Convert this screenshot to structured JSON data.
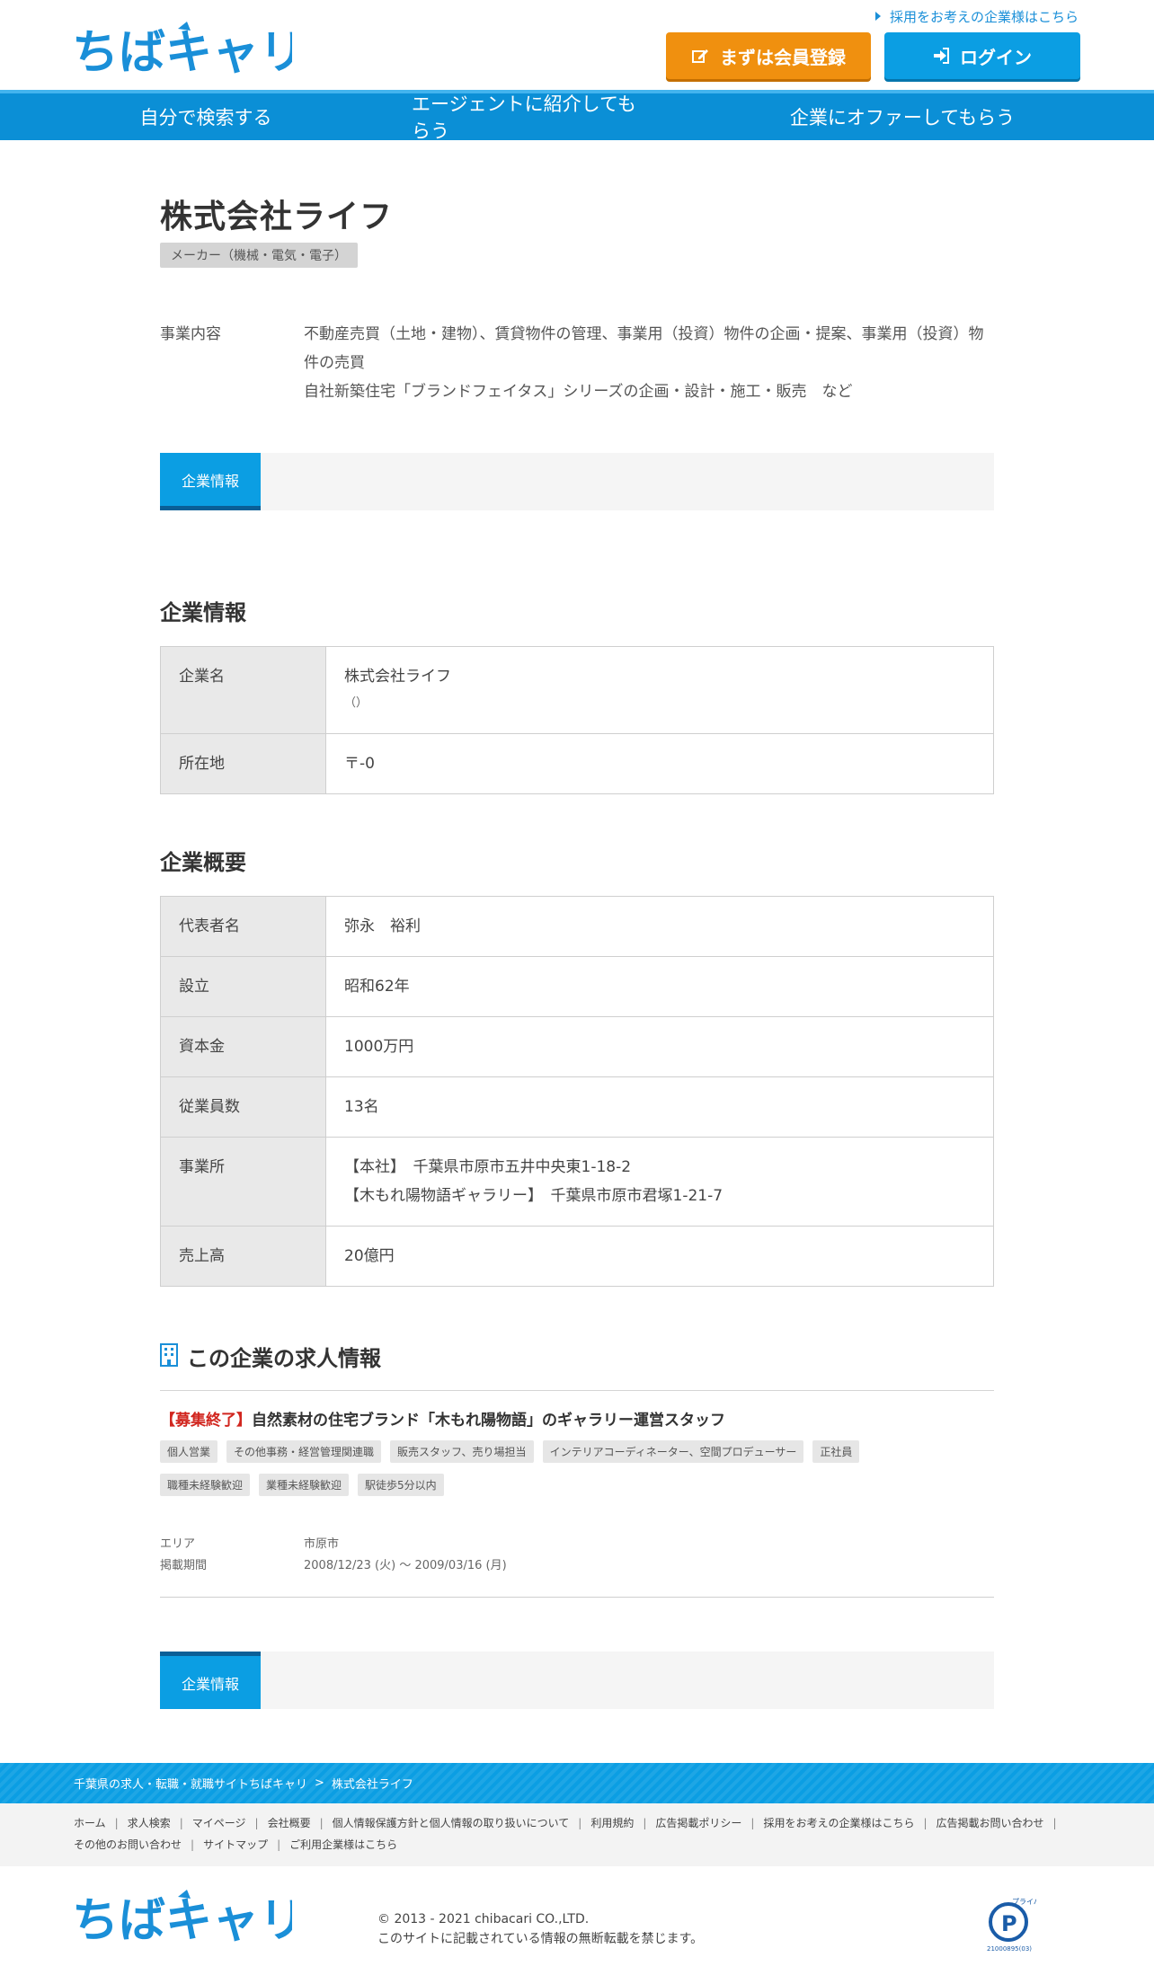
{
  "header": {
    "logo_text": "ちばキャリ",
    "corporate_link": "採用をお考えの企業様はこちら",
    "register_label": "まずは会員登録",
    "login_label": "ログイン"
  },
  "nav": {
    "items": [
      "自分で検索する",
      "エージェントに紹介してもらう",
      "企業にオファーしてもらう"
    ]
  },
  "company": {
    "name": "株式会社ライフ",
    "industry": "メーカー（機械・電気・電子）",
    "business_label": "事業内容",
    "business_line1": "不動産売買（土地・建物）、賃貸物件の管理、事業用（投資）物件の企画・提案、事業用（投資）物件の売買",
    "business_line2": "自社新築住宅「ブランドフェイタス」シリーズの企画・設計・施工・販売　など"
  },
  "tab_label": "企業情報",
  "info_section": {
    "heading": "企業情報",
    "rows": [
      {
        "label": "企業名",
        "value": "株式会社ライフ",
        "sub": "（）"
      },
      {
        "label": "所在地",
        "value": "〒-0"
      }
    ]
  },
  "overview_section": {
    "heading": "企業概要",
    "rows": [
      {
        "label": "代表者名",
        "value": "弥永　裕利"
      },
      {
        "label": "設立",
        "value": "昭和62年"
      },
      {
        "label": "資本金",
        "value": "1000万円"
      },
      {
        "label": "従業員数",
        "value": "13名"
      },
      {
        "label": "事業所",
        "value": "【本社】　千葉県市原市五井中央東1-18-2",
        "value2": "【木もれ陽物語ギャラリー】　千葉県市原市君塚1-21-7"
      },
      {
        "label": "売上高",
        "value": "20億円"
      }
    ]
  },
  "jobs": {
    "heading": "この企業の求人情報",
    "job": {
      "status": "【募集終了】",
      "title": "自然素材の住宅ブランド「木もれ陽物語」のギャラリー運営スタッフ",
      "tags": [
        "個人営業",
        "その他事務・経営管理関連職",
        "販売スタッフ、売り場担当",
        "インテリアコーディネーター、空間プロデューサー",
        "正社員",
        "職種未経験歓迎",
        "業種未経験歓迎",
        "駅徒歩5分以内"
      ],
      "area_label": "エリア",
      "area": "市原市",
      "period_label": "掲載期間",
      "period": "2008/12/23 (火) ～ 2009/03/16 (月)"
    }
  },
  "footer": {
    "breadcrumb": [
      "千葉県の求人・転職・就職サイトちばキャリ",
      "株式会社ライフ"
    ],
    "breadcrumb_sep": ">",
    "links": [
      "ホーム",
      "求人検索",
      "マイページ",
      "会社概要",
      "個人情報保護方針と個人情報の取り扱いについて",
      "利用規約",
      "広告掲載ポリシー",
      "採用をお考えの企業様はこちら",
      "広告掲載お問い合わせ",
      "その他のお問い合わせ",
      "サイトマップ",
      "ご利用企業様はこちら"
    ],
    "link_sep": "|",
    "copyright": "© 2013 - 2021 chibacari CO.,LTD.",
    "notice": "このサイトに記載されている情報の無断転載を禁じます。",
    "privacy_text": "プライバシー",
    "privacy_number": "21000895(03)"
  },
  "colors": {
    "brand_blue": "#0b9ee3",
    "nav_blue": "#0b8fd6",
    "register_orange": "#f0900f",
    "closed_red": "#d1261f"
  }
}
